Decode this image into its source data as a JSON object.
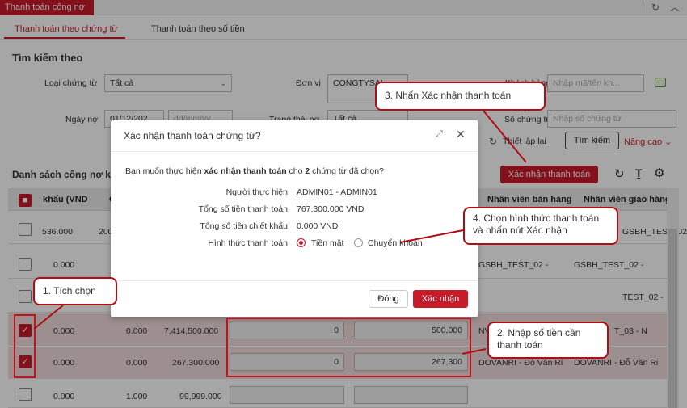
{
  "app_tab": "Thanh toán công nợ",
  "subtabs": {
    "by_document": "Thanh toán theo chứng từ",
    "by_amount": "Thanh toán theo số tiền"
  },
  "search": {
    "title": "Tìm kiếm theo",
    "doc_type_label": "Loại chứng từ",
    "doc_type_value": "Tất cả",
    "unit_label": "Đơn vị",
    "unit_value": "CONGTYSAI",
    "customer_label": "Khách hàng",
    "customer_placeholder": "Nhập mã/tên kh...",
    "date_label": "Ngày nợ",
    "date_from": "01/12/202",
    "date_to_placeholder": "dd/mm/yy",
    "status_label": "Trạng thái nợ",
    "status_value": "Tất cả",
    "doc_no_label": "Số chứng từ",
    "doc_no_placeholder": "Nhập số chứng từ",
    "reset_label": "Thiết lập lại",
    "search_button": "Tìm kiếm",
    "advanced_label": "Nâng cao"
  },
  "list": {
    "title": "Danh sách công nợ khách",
    "confirm_button": "Xác nhận thanh toán",
    "headers": {
      "discount": "khẩu (VND",
      "col2": "C",
      "sales_staff": "Nhân viên bán hàng",
      "delivery_staff": "Nhân viên giao hàng"
    },
    "rows": [
      {
        "c1": "536.000",
        "c2": "200",
        "c3": "",
        "pay1": "",
        "pay2": "",
        "sales": "",
        "delivery": "GSBH_TEST_02 -"
      },
      {
        "c1": "0.000",
        "c2": "",
        "c3": "",
        "pay1": "",
        "pay2": "",
        "sales": "GSBH_TEST_02 -",
        "delivery": "GSBH_TEST_02 -"
      },
      {
        "c1": "",
        "c2": "",
        "c3": "",
        "pay1": "",
        "pay2": "",
        "sales": "",
        "delivery": "TEST_02 -"
      },
      {
        "c1": "0.000",
        "c2": "0.000",
        "c3": "7,414,500.000",
        "pay1": "0",
        "pay2": "500,000",
        "sales": "NV",
        "delivery": "T_03 - N"
      },
      {
        "c1": "0.000",
        "c2": "0.000",
        "c3": "267,300.000",
        "pay1": "0",
        "pay2": "267,300",
        "sales": "DOVANRI - Đỗ Văn Ri",
        "delivery": "DOVANRI - Đỗ Văn Ri"
      },
      {
        "c1": "0.000",
        "c2": "1.000",
        "c3": "99,999.000",
        "pay1": "",
        "pay2": "",
        "sales": "",
        "delivery": ""
      }
    ]
  },
  "dialog": {
    "title": "Xác nhận thanh toán chứng từ?",
    "question_prefix": "Bạn muốn thực hiện",
    "question_bold": "xác nhận thanh toán",
    "question_middle": "cho",
    "question_count": "2",
    "question_suffix": "chứng từ đã chọn?",
    "performer_label": "Người thực hiện",
    "performer_value": "ADMIN01 - ADMIN01",
    "total_pay_label": "Tổng số tiền thanh toán",
    "total_pay_value": "767,300.000  VND",
    "total_discount_label": "Tổng số tiền chiết khấu",
    "total_discount_value": "0.000  VND",
    "method_label": "Hình thức thanh toán",
    "method_cash": "Tiền mặt",
    "method_transfer": "Chuyển khoản",
    "close_button": "Đóng",
    "confirm_button": "Xác nhận"
  },
  "annotations": {
    "step1": "1. Tích chọn",
    "step2": "2. Nhập số tiền cần thanh toán",
    "step3": "3. Nhấn Xác nhận thanh toán",
    "step4": "4. Chọn hình thức thanh toán và nhấn nút Xác nhận"
  },
  "colors": {
    "accent": "#c81b2a",
    "annotation_border": "#b30d14"
  }
}
